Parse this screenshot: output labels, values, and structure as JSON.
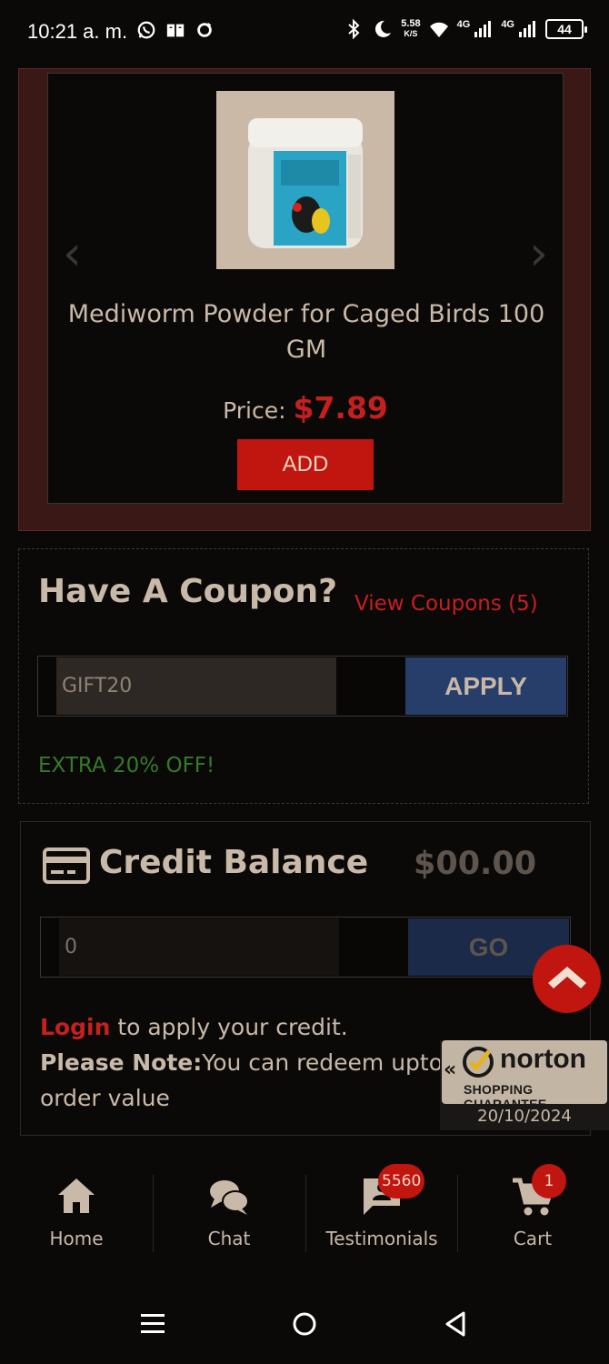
{
  "status_bar": {
    "time": "10:21 a. m.",
    "speed_value": "5.58",
    "speed_unit": "K/S",
    "net1": "4G",
    "net2": "4G",
    "battery": "44"
  },
  "product": {
    "image_icon": "product-jar-image",
    "title": "Mediworm Powder for Caged Birds 100 GM",
    "price_label": "Price:",
    "price_value": "$7.89",
    "add_label": "ADD",
    "prev_arrow": "‹",
    "next_arrow": "›"
  },
  "coupon": {
    "title": "Have A Coupon?",
    "view_link": "View Coupons (5)",
    "input_value": "GIFT20",
    "apply_label": "APPLY",
    "offer_text": "EXTRA 20% OFF!"
  },
  "credit": {
    "title": "Credit Balance",
    "amount": "$00.00",
    "input_placeholder": "0",
    "go_label": "GO",
    "login_link": "Login",
    "login_text": " to apply your credit.",
    "note_label": "Please Note:",
    "note_text": "You can redeem upto 20",
    "note_text2": "order value"
  },
  "norton": {
    "chevron": "«",
    "word": "norton",
    "sub": "SHOPPING GUARANTEE",
    "date": "20/10/2024"
  },
  "bottom_nav": {
    "items": [
      {
        "label": "Home",
        "icon": "home-icon"
      },
      {
        "label": "Chat",
        "icon": "chat-icon"
      },
      {
        "label": "Testimonials",
        "icon": "testimonials-icon",
        "badge": "5560"
      },
      {
        "label": "Cart",
        "icon": "cart-icon",
        "badge": "1"
      }
    ]
  },
  "colors": {
    "accent_red": "#c1150f",
    "apply_blue": "#273e6b",
    "offer_green": "#357a2a"
  }
}
